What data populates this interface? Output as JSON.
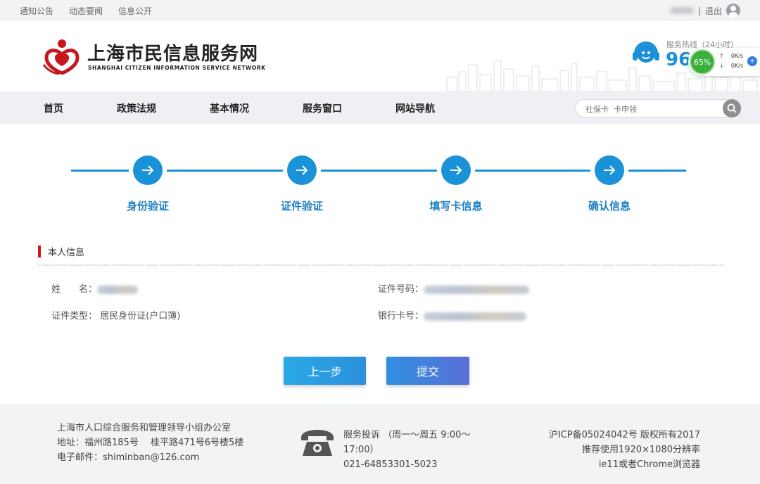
{
  "topbar": {
    "links": [
      "通知公告",
      "动态要闻",
      "信息公开"
    ],
    "logout": "退出"
  },
  "header": {
    "site_title": "上海市民信息服务网",
    "site_subtitle": "SHANGHAI CITIZEN INFORMATION SERVICE NETWORK",
    "hotline_label": "服务热线（24小时）",
    "hotline_number": "96"
  },
  "network_widget": {
    "percent": "65%",
    "upload": "0K/s",
    "download": "0K/s",
    "plus": "+"
  },
  "nav": {
    "items": [
      "首页",
      "政策法规",
      "基本情况",
      "服务窗口",
      "网站导航"
    ],
    "search_placeholder": "社保卡  卡申领"
  },
  "steps": [
    {
      "label": "身份验证"
    },
    {
      "label": "证件验证"
    },
    {
      "label": "填写卡信息"
    },
    {
      "label": "确认信息"
    }
  ],
  "personal_info": {
    "section_title": "本人信息",
    "name_label": "姓　　名：",
    "id_type_label": "证件类型：",
    "id_type_value": "居民身份证(户口簿)",
    "id_number_label": "证件号码：",
    "bank_card_label": "银行卡号："
  },
  "buttons": {
    "prev": "上一步",
    "submit": "提交"
  },
  "footer": {
    "org": "上海市人口综合服务和管理领导小组办公室",
    "address": "地址：福州路185号　 桂平路471号6号楼5楼",
    "email": "电子邮件：shiminban@126.com",
    "complaint": "服务投诉 （周一～周五 9:00～17:00）",
    "complaint_phone": "021-64853301-5023",
    "icp": "沪ICP备05024042号 版权所有2017",
    "resolution": "推荐使用1920×1080分辨率",
    "browser": "ie11或者Chrome浏览器"
  },
  "colors": {
    "accent": "#1a92d8",
    "section_marker": "#d7141a",
    "nav_bg": "#eef0f3",
    "footer_bg": "#f2f3f5"
  }
}
